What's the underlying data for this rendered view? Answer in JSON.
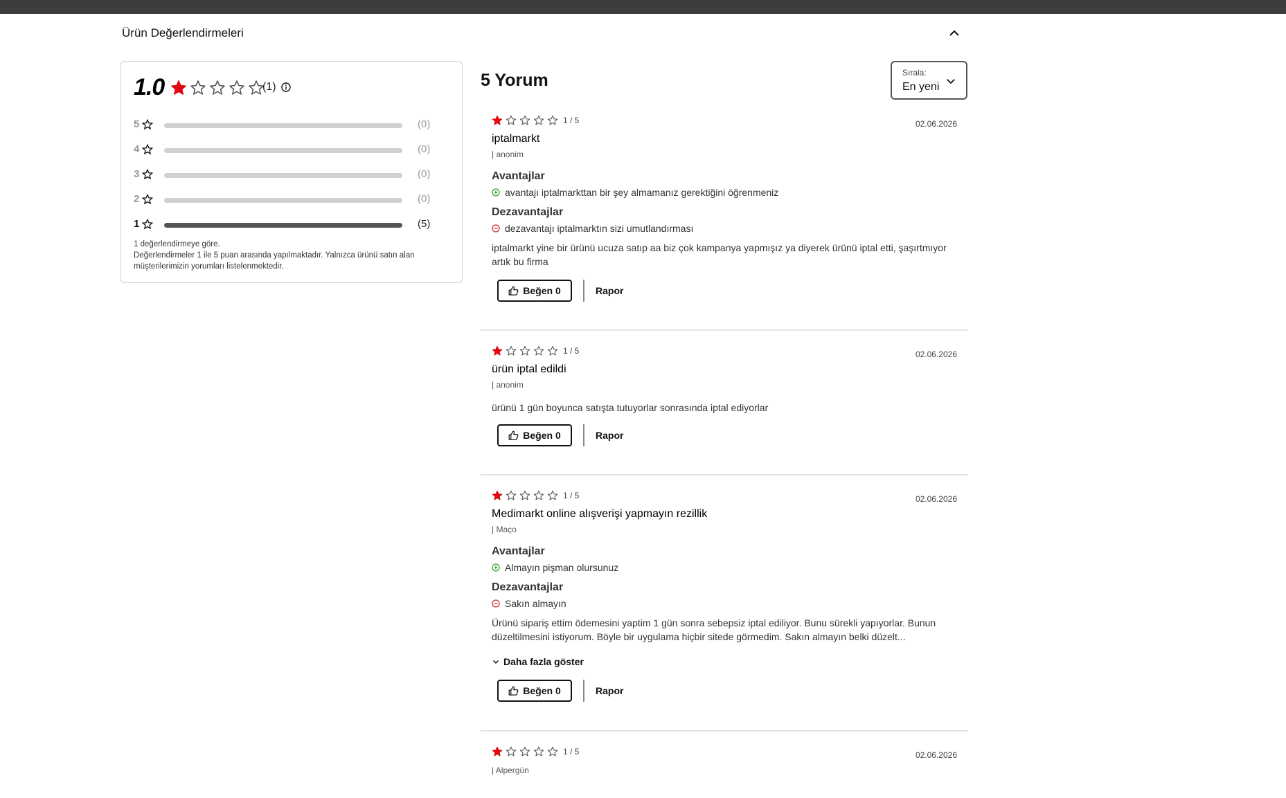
{
  "section": {
    "title": "Ürün Değerlendirmeleri"
  },
  "summary": {
    "average": "1.0",
    "rating_value": 1,
    "rating_max": 5,
    "count_label": "(1)",
    "distribution": [
      {
        "label": "5",
        "count": "(0)",
        "fraction": 0
      },
      {
        "label": "4",
        "count": "(0)",
        "fraction": 0
      },
      {
        "label": "3",
        "count": "(0)",
        "fraction": 0
      },
      {
        "label": "2",
        "count": "(0)",
        "fraction": 0
      },
      {
        "label": "1",
        "count": "(5)",
        "fraction": 1
      }
    ],
    "note_line1": "1 değerlendirmeye göre.",
    "note_line2": "Değerlendirmeler 1 ile 5 puan arasında yapılmaktadır. Yalnızca ürünü satın alan müşterilerimizin yorumları listelenmektedir."
  },
  "reviews_header": {
    "count_label": "5 Yorum"
  },
  "sort": {
    "label": "Sırala:",
    "value": "En yeni"
  },
  "colors": {
    "star_active": "#e30613",
    "star_inactive": "#555555",
    "pro_green": "#3a9b3a",
    "con_red": "#d12b2b"
  },
  "labels": {
    "pros": "Avantajlar",
    "cons": "Dezavantajlar",
    "like": "Beğen 0",
    "report": "Rapor",
    "show_more": "Daha fazla göster"
  },
  "reviews": [
    {
      "rating": 1,
      "score": "1 / 5",
      "date": "02.06.2026",
      "title": "iptalmarkt",
      "author": "| anonim",
      "pro": "avantajı iptalmarkttan bir şey almamanız gerektiğini öğrenmeniz",
      "con": "dezavantajı iptalmarktın sizi umutlandırması",
      "body": "iptalmarkt yine bir ürünü ucuza satıp aa biz çok kampanya yapmışız ya diyerek ürünü iptal etti, şaşırtmıyor artık bu firma"
    },
    {
      "rating": 1,
      "score": "1 / 5",
      "date": "02.06.2026",
      "title": "ürün iptal edildi",
      "author": "| anonim",
      "body": "ürünü 1 gün boyunca satışta tutuyorlar sonrasında iptal ediyorlar"
    },
    {
      "rating": 1,
      "score": "1 / 5",
      "date": "02.06.2026",
      "title": "Medimarkt online alışverişi yapmayın rezillik",
      "author": "| Maço",
      "pro": "Almayın pişman olursunuz",
      "con": "Sakın almayın",
      "body": "Ürünü sipariş ettim ödemesini yaptim 1 gün sonra sebepsiz iptal ediliyor. Bunu sürekli yapıyorlar. Bunun düzeltilmesini istiyorum. Böyle bir uygulama hiçbir sitede görmedim. Sakın almayın belki düzelt..."
    },
    {
      "rating": 1,
      "score": "1 / 5",
      "date": "02.06.2026",
      "author": "| Alpergün"
    }
  ]
}
